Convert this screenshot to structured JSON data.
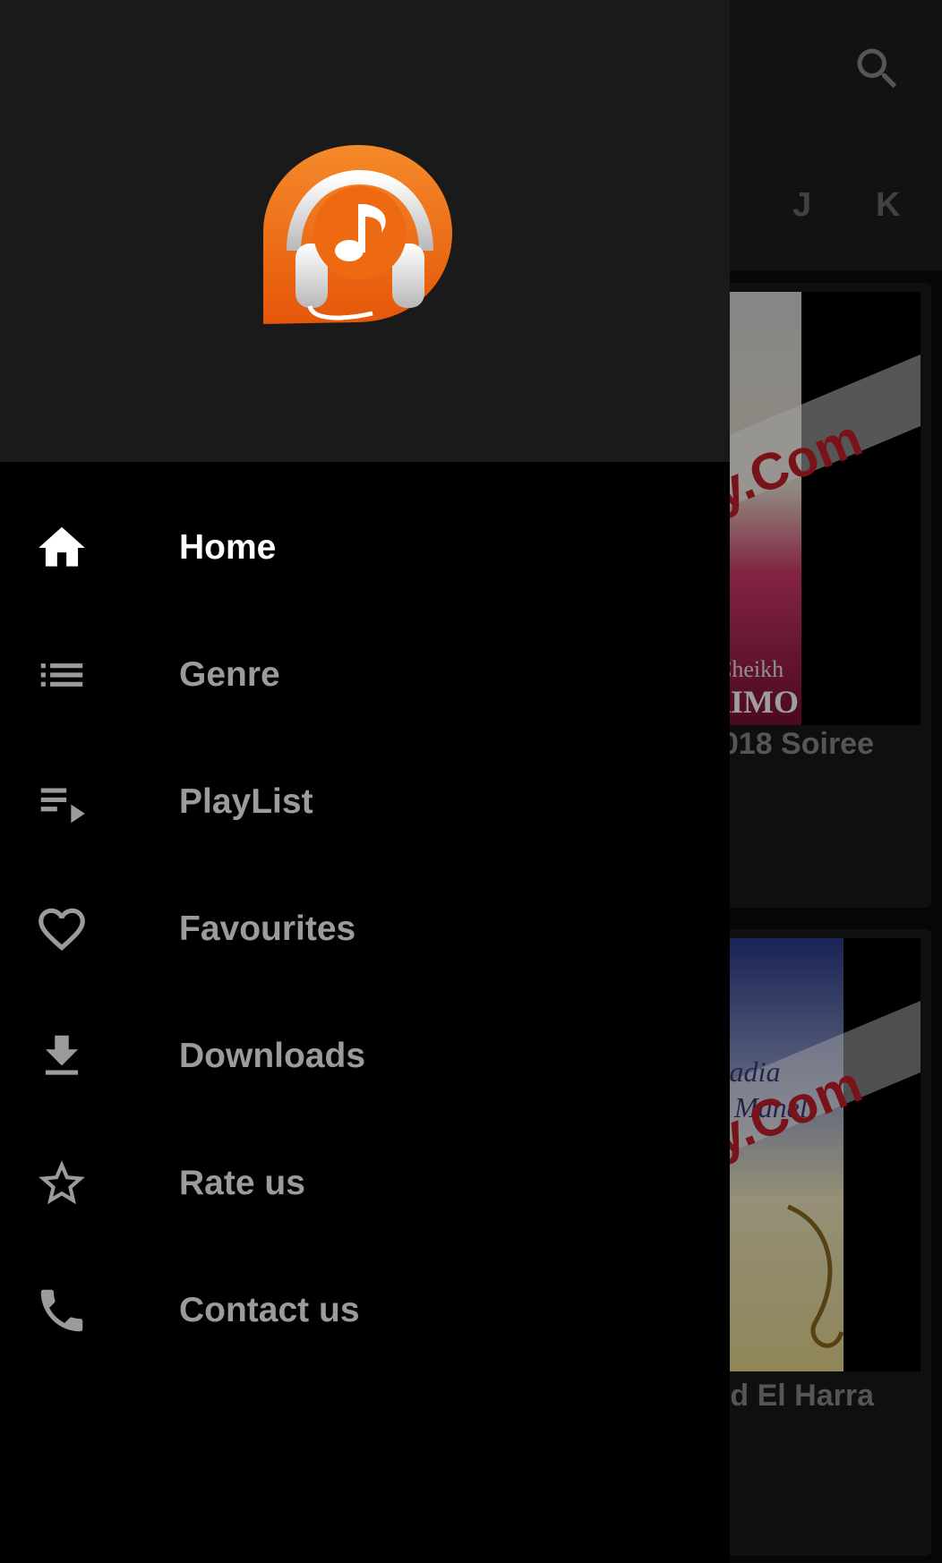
{
  "app": {
    "letter_tabs": [
      "J",
      "K"
    ],
    "cards": [
      {
        "title": "018 Soiree",
        "art_text_1": "Cheikh",
        "art_text_2": "RIMO",
        "watermark": "y.Com"
      },
      {
        "title": "Wlid El Harra",
        "art_text_1": "Radia",
        "art_text_2": "Manel",
        "watermark": "y.Com"
      }
    ]
  },
  "drawer": {
    "logo_icon": "music-headphones-logo",
    "items": [
      {
        "label": "Home",
        "icon": "home-icon",
        "active": true
      },
      {
        "label": "Genre",
        "icon": "list-icon"
      },
      {
        "label": "PlayList",
        "icon": "playlist-icon"
      },
      {
        "label": "Favourites",
        "icon": "heart-icon"
      },
      {
        "label": "Downloads",
        "icon": "download-icon"
      },
      {
        "label": "Rate us",
        "icon": "star-icon"
      },
      {
        "label": "Contact us",
        "icon": "phone-icon"
      }
    ]
  },
  "colors": {
    "logo_orange": "#f06a10",
    "active_text": "#ffffff",
    "inactive_text": "#9b9b9b"
  }
}
